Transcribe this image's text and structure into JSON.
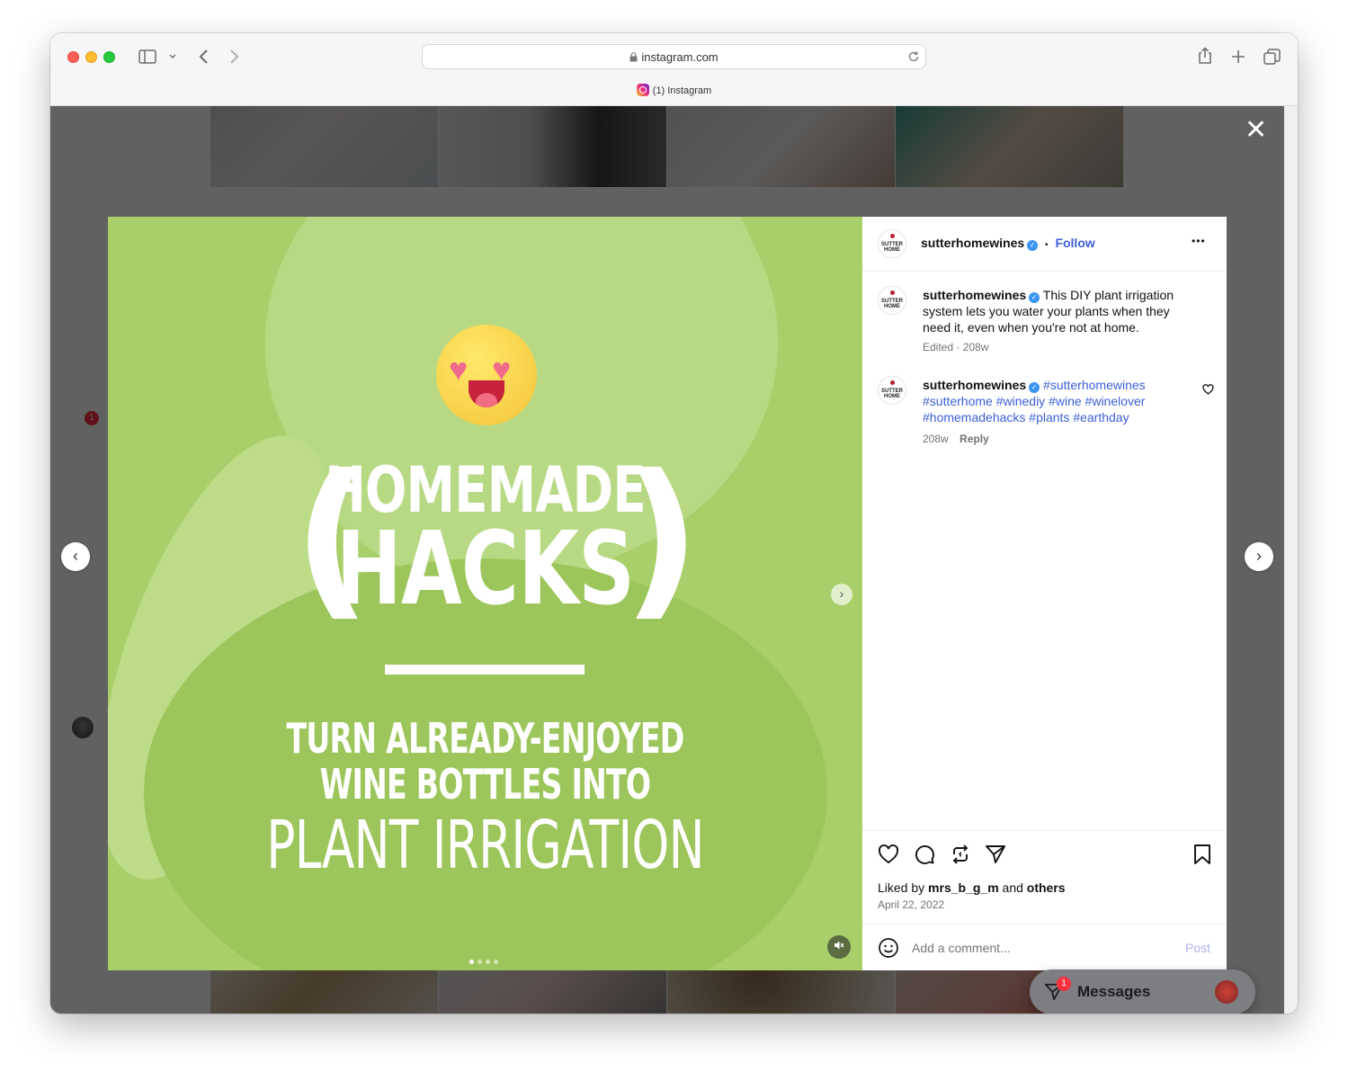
{
  "browser": {
    "url": "instagram.com",
    "tab_title": "(1) Instagram"
  },
  "sidebar": {
    "notifications_badge": "1"
  },
  "post": {
    "username": "sutterhomewines",
    "follow_label": "Follow",
    "more_label": "•••",
    "avatar_text": "SUTTER HOME",
    "media": {
      "title_line1": "HOMEMADE",
      "title_line2": "HACKS",
      "subtitle_line1": "TURN ALREADY-ENJOYED",
      "subtitle_line2": "WINE BOTTLES INTO",
      "subtitle_line3": "PLANT IRRIGATION"
    },
    "caption": {
      "username": "sutterhomewines",
      "text": "This DIY plant irrigation system lets you water your plants when they need it, even when you're not at home.",
      "meta": "Edited · 208w"
    },
    "comment": {
      "username": "sutterhomewines",
      "hashtags": "#sutterhomewines #sutterhome #winediy #wine #winelover #homemadehacks #plants #earthday",
      "age": "208w",
      "reply_label": "Reply"
    },
    "likes": {
      "prefix": "Liked by",
      "user": "mrs_b_g_m",
      "and": "and",
      "others": "others"
    },
    "date": "April 22, 2022",
    "comment_input": {
      "placeholder": "Add a comment...",
      "post_label": "Post"
    }
  },
  "messages": {
    "label": "Messages",
    "badge": "1"
  },
  "colors": {
    "media_green": "#a8cf6a",
    "link_blue": "#3d5fd9",
    "verified_blue": "#3b96f3",
    "badge_red": "#ff3040"
  }
}
